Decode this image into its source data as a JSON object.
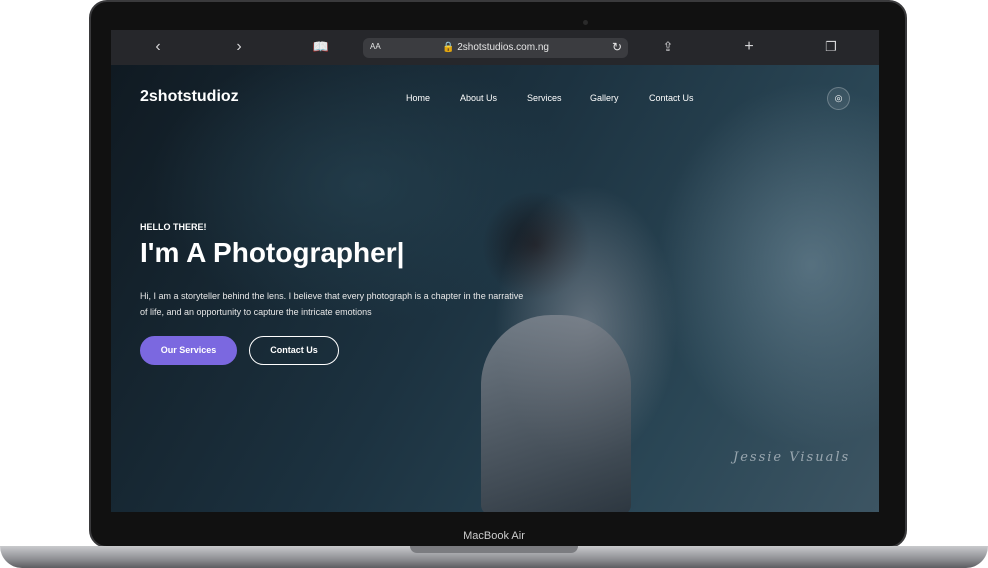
{
  "browser": {
    "url": "2shotstudios.com.ng",
    "text_size_label": "AA"
  },
  "site": {
    "logo": "2shotstudioz",
    "nav": [
      "Home",
      "About Us",
      "Services",
      "Gallery",
      "Contact Us"
    ],
    "hero": {
      "eyebrow": "HELLO THERE!",
      "title": "I'm A Photographer|",
      "description": "Hi, I am a storyteller behind the lens. I believe that every photograph is a chapter in the narrative of life, and an opportunity to capture the intricate emotions",
      "primary_button": "Our Services",
      "secondary_button": "Contact Us"
    },
    "watermark": "Jessie Visuals"
  },
  "device": {
    "label": "MacBook Air"
  },
  "colors": {
    "accent": "#7b68e0"
  }
}
